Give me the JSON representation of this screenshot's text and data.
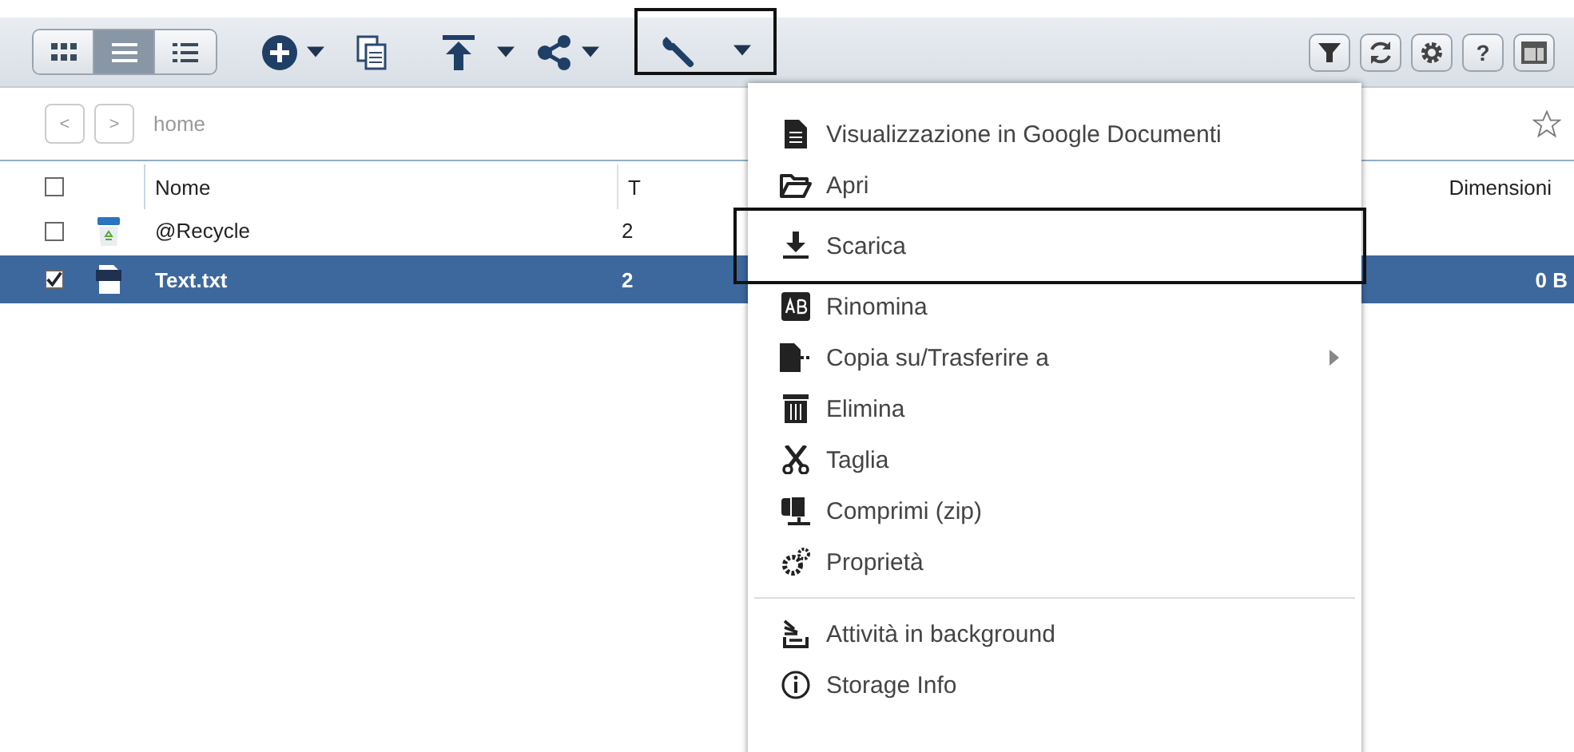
{
  "toolbar": {
    "view_buttons": [
      {
        "selected": false
      },
      {
        "selected": true
      },
      {
        "selected": false
      }
    ],
    "tools_button": {
      "highlighted": true
    },
    "help_button": {
      "label": "?"
    }
  },
  "breadcrumb": {
    "nav_buttons": [
      "<",
      ">"
    ],
    "path": "home"
  },
  "table": {
    "select_all": {
      "checked": false
    },
    "columns": [
      "Nome",
      "T",
      "Dimensioni"
    ],
    "rows": [
      {
        "kind": "recycle",
        "name": "@Recycle",
        "column_3": "2",
        "size": "",
        "checked": false,
        "selected": false
      },
      {
        "kind": "txt",
        "name": "Text.txt",
        "column_3": "2",
        "size": "0 B",
        "checked": true,
        "selected": true
      }
    ]
  },
  "menu": {
    "sections": [
      {
        "items": [
          {
            "label": "Visualizzazione in Google Documenti",
            "kind": "item",
            "highlighted": false
          },
          {
            "label": "Apri",
            "kind": "item",
            "highlighted": false
          }
        ]
      },
      {
        "items": [
          {
            "label": "Scarica",
            "kind": "item",
            "highlighted": true
          }
        ]
      },
      {
        "items": [
          {
            "label": "Rinomina",
            "kind": "item",
            "highlighted": false
          },
          {
            "label": "Copia su/Trasferire a",
            "kind": "submenu",
            "highlighted": false
          },
          {
            "label": "Elimina",
            "kind": "item",
            "highlighted": false
          },
          {
            "label": "Taglia",
            "kind": "item",
            "highlighted": false
          },
          {
            "label": "Comprimi (zip)",
            "kind": "item",
            "highlighted": false
          },
          {
            "label": "Proprietà",
            "kind": "item",
            "highlighted": false
          }
        ]
      },
      {
        "items": [
          {
            "label": "Attività in background",
            "kind": "item",
            "highlighted": false
          },
          {
            "label": "Storage Info",
            "kind": "item",
            "highlighted": false
          }
        ]
      }
    ]
  }
}
